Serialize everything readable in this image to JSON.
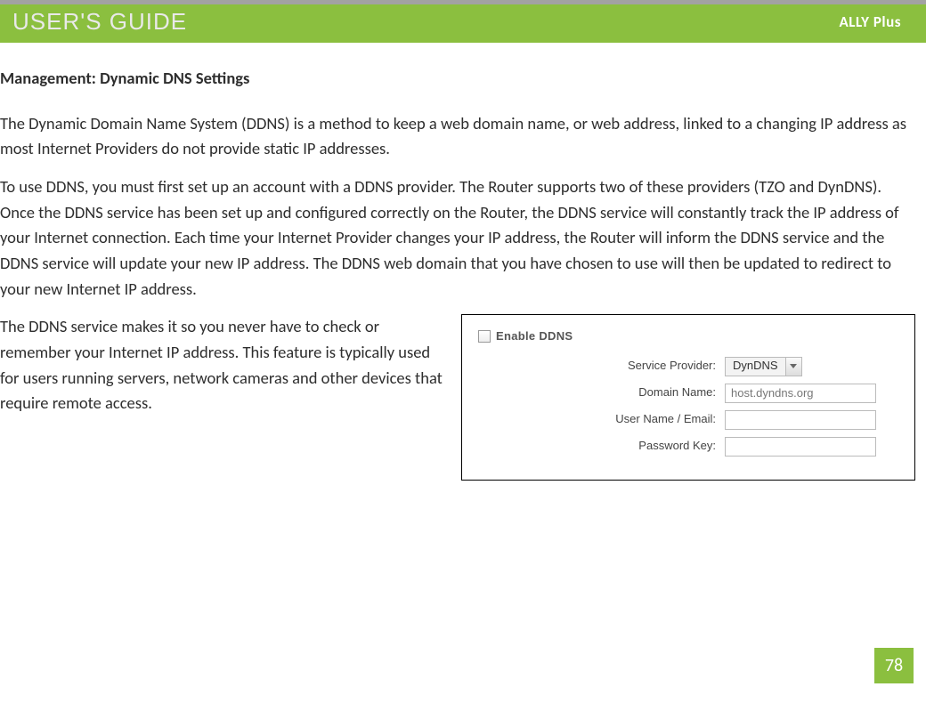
{
  "header": {
    "guide_title": "USER'S GUIDE",
    "product": "ALLY Plus"
  },
  "section_title": "Management: Dynamic DNS Settings",
  "paragraphs": {
    "p1": "The Dynamic Domain Name System (DDNS) is a method to keep a web domain name, or web address, linked to a changing IP address as most Internet Providers do not provide static IP addresses.",
    "p2": "To use DDNS, you must first set up an account with a DDNS provider. The Router supports two of these providers (TZO and DynDNS). Once the DDNS service has been set up and configured correctly on the Router, the DDNS service will constantly track the IP address of your Internet connection. Each time your Internet Provider changes your IP address, the Router will inform the DDNS service and the DDNS service will update your new IP address.  The DDNS web domain that you have chosen to use will then be updated to redirect to your new Internet IP address.",
    "p3": "The DDNS service makes it so you never have to check or remember your Internet IP address. This feature is typically used for users running servers, network cameras and other devices that require remote access."
  },
  "ddns_panel": {
    "enable_label": "Enable DDNS",
    "fields": {
      "service_provider": {
        "label": "Service Provider:",
        "value": "DynDNS"
      },
      "domain_name": {
        "label": "Domain Name:",
        "value": "host.dyndns.org"
      },
      "user_name": {
        "label": "User Name / Email:",
        "value": ""
      },
      "password": {
        "label": "Password Key:",
        "value": ""
      }
    }
  },
  "page_number": "78"
}
